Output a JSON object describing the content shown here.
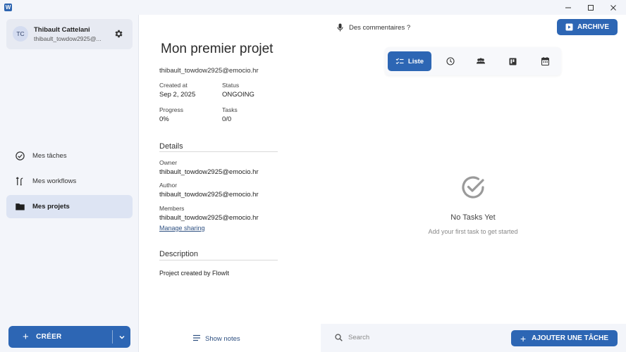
{
  "window": {
    "logo_letter": "W",
    "minimize_glyph": "─",
    "maximize_glyph": "☐",
    "close_glyph": "✕"
  },
  "user": {
    "initials": "TC",
    "name": "Thibault Cattelani",
    "email": "thibault_towdow2925@..."
  },
  "sidebar": {
    "items": [
      {
        "label": "Mes tâches",
        "icon": "check-circle-icon",
        "active": false
      },
      {
        "label": "Mes workflows",
        "icon": "workflow-icon",
        "active": false
      },
      {
        "label": "Mes projets",
        "icon": "folder-icon",
        "active": true
      }
    ],
    "create_label": "CRÉER",
    "create_plus": "+"
  },
  "project": {
    "title": "Mon premier projet",
    "email": "thibault_towdow2925@emocio.hr",
    "created_at_label": "Created at",
    "created_at": "Sep 2, 2025",
    "status_label": "Status",
    "status": "ONGOING",
    "progress_label": "Progress",
    "progress": "0%",
    "tasks_label": "Tasks",
    "tasks": "0/0",
    "details_title": "Details",
    "owner_label": "Owner",
    "owner": "thibault_towdow2925@emocio.hr",
    "author_label": "Author",
    "author": "thibault_towdow2925@emocio.hr",
    "members_label": "Members",
    "members": "thibault_towdow2925@emocio.hr",
    "manage_sharing": "Manage sharing",
    "description_title": "Description",
    "description": "Project created by FlowIt",
    "show_notes": "Show notes"
  },
  "main": {
    "feedback": "Des commentaires ?",
    "archive_label": "ARCHIVE",
    "views": [
      {
        "label": "Liste",
        "icon": "list-icon",
        "active": true
      },
      {
        "label": "",
        "icon": "clock-icon",
        "active": false
      },
      {
        "label": "",
        "icon": "people-icon",
        "active": false
      },
      {
        "label": "",
        "icon": "kanban-icon",
        "active": false
      },
      {
        "label": "",
        "icon": "calendar-icon",
        "active": false
      }
    ],
    "empty_title": "No Tasks Yet",
    "empty_subtitle": "Add your first task to get started",
    "search_placeholder": "Search",
    "add_task_label": "AJOUTER UNE TÂCHE",
    "add_task_plus": "+"
  },
  "colors": {
    "accent": "#2d66b4",
    "sidebar_bg": "#f3f5fa",
    "active_nav_bg": "#dde4f3"
  }
}
